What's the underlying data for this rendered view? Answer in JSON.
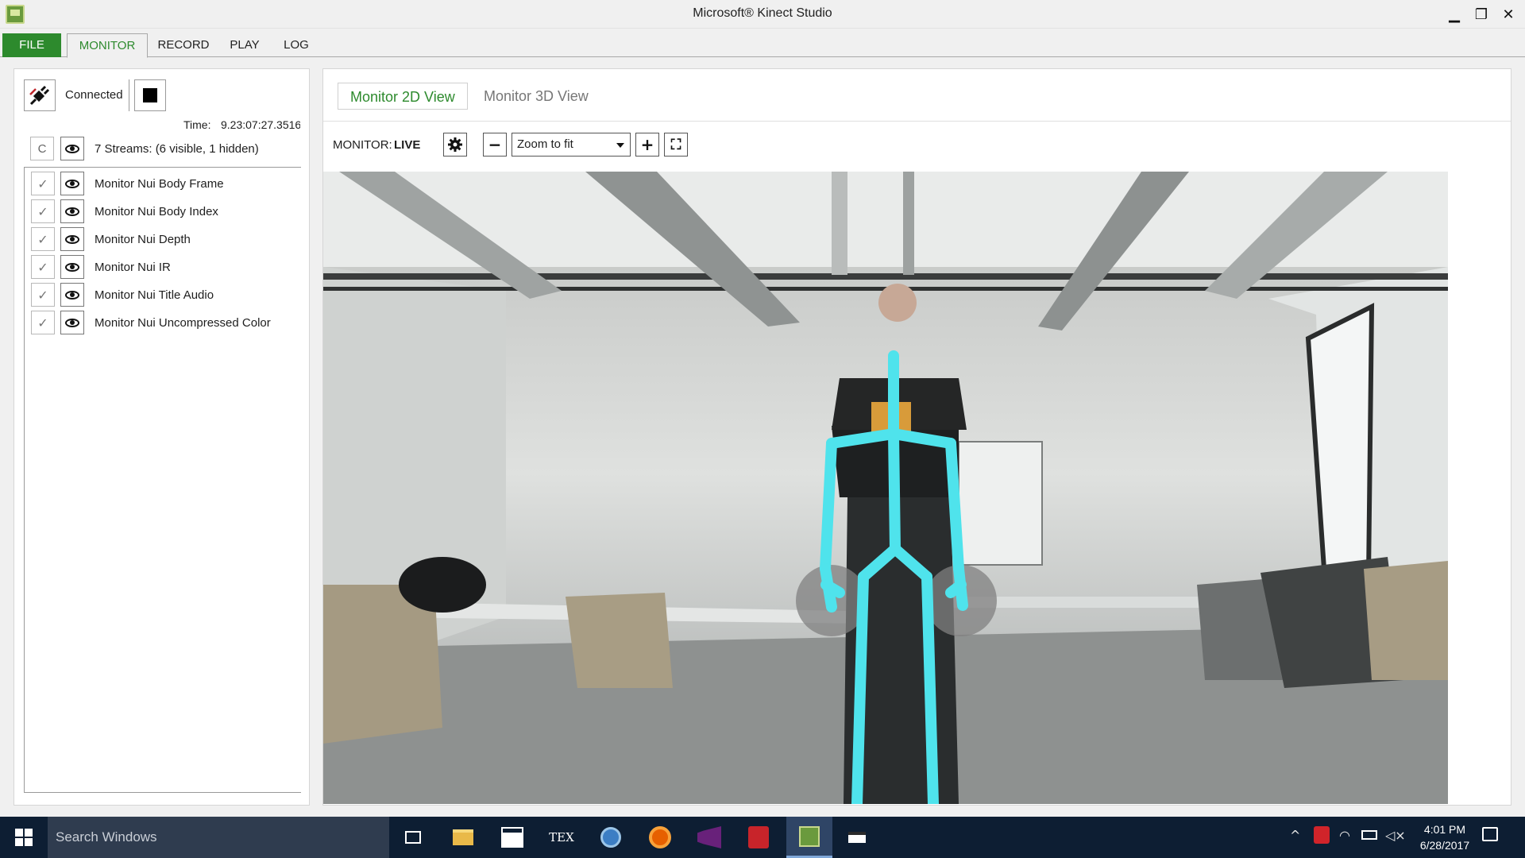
{
  "window": {
    "title": "Microsoft® Kinect Studio",
    "minimize_glyph": "▁",
    "restore_glyph": "❐",
    "close_glyph": "✕"
  },
  "menu": {
    "file": "FILE",
    "monitor": "MONITOR",
    "record": "RECORD",
    "play": "PLAY",
    "log": "LOG"
  },
  "left_panel": {
    "connection_status": "Connected",
    "time_label": "Time:",
    "time_value": "9.23:07:27.3516",
    "c_button": "C",
    "streams_summary": "7 Streams: (6 visible, 1 hidden)",
    "streams": [
      {
        "name": "Monitor Nui Body Frame",
        "checked": true
      },
      {
        "name": "Monitor Nui Body Index",
        "checked": true
      },
      {
        "name": "Monitor Nui Depth",
        "checked": true
      },
      {
        "name": "Monitor Nui IR",
        "checked": true
      },
      {
        "name": "Monitor Nui Title Audio",
        "checked": true
      },
      {
        "name": "Monitor Nui Uncompressed Color",
        "checked": true
      }
    ],
    "check_glyph": "✓"
  },
  "view_tabs": {
    "tab_2d": "Monitor 2D View",
    "tab_3d": "Monitor 3D View"
  },
  "toolbar": {
    "monitor_label": "MONITOR:",
    "monitor_state": "LIVE",
    "zoom_value": "Zoom to fit",
    "zoom_out": "−",
    "zoom_in": "+",
    "fullscreen": "⛶"
  },
  "viewport": {
    "skeleton_color": "#4fe3ec",
    "hand_state_color": "#808080"
  },
  "taskbar": {
    "search_placeholder": "Search Windows",
    "time": "4:01 PM",
    "date": "6/28/2017",
    "icons": [
      "task-view",
      "file-explorer",
      "store",
      "tex",
      "thunderbird",
      "firefox",
      "visual-studio",
      "pdf-editor",
      "kinect-studio",
      "app-console"
    ]
  },
  "colors": {
    "accent": "#2d8a2d",
    "taskbar": "#0d1e33"
  }
}
